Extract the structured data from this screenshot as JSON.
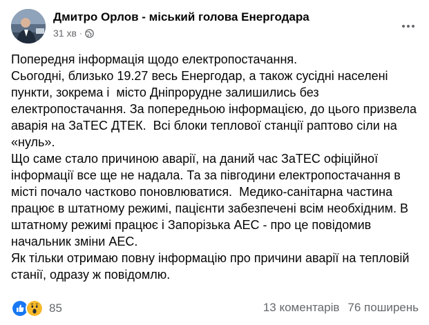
{
  "post": {
    "author": "Дмитро Орлов - міський голова Енергодара",
    "time": "31 хв",
    "separator": "·",
    "privacy_icon": "globe-icon",
    "menu_icon": "more-icon",
    "paragraphs": [
      "Попередня інформація щодо електропостачання.",
      "Сьогодні, близько 19.27 весь Енергодар, а також сусідні населені пункти, зокрема і  місто Дніпрорудне залишились без електропостачання. За попередньою інформацією, до цього призвела аварія на ЗаТЕС ДТЕК.  Всі блоки теплової станції раптово сіли на «нуль».",
      "Що саме стало причиною аварії, на даний час ЗаТЕС офіційної інформації все ще не надала. Та за пiвгодини електропостачання в місті почало частково поновлюватися.  Медико-санітарна частина працює в штатному режимі, пацієнти забезпечені всім необхідним. В штатному режимі працює і Запорізька АЕС - про це повідомив начальник зміни АЕС.",
      "Як тільки отримаю повну інформацію про причини аварії на тепловій станії, одразу ж повідомлю."
    ]
  },
  "footer": {
    "reaction_icons": [
      "like-icon",
      "wow-icon"
    ],
    "reactions_count": "85",
    "comments": "13 коментарів",
    "shares": "76 поширень"
  },
  "colors": {
    "text": "#050505",
    "secondary": "#65676b",
    "like_blue": "#1877f2",
    "wow_yellow": "#f7b928"
  }
}
